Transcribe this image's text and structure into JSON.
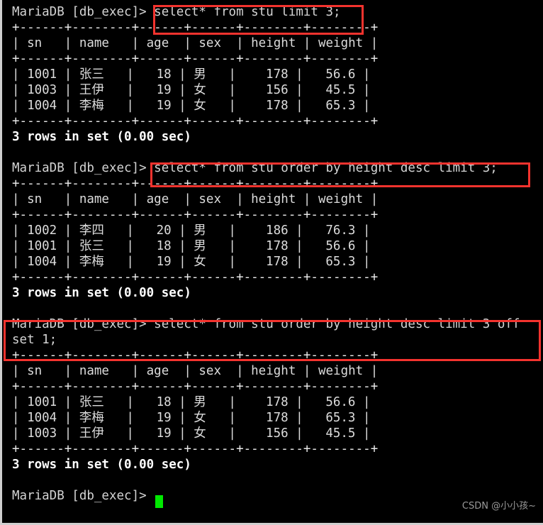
{
  "terminal": {
    "prompt": "MariaDB [db_exec]> ",
    "cursor_color": "#00e800",
    "text_color": "#d4d4d4",
    "background_color": "#000000",
    "highlight_color": "#f4332e",
    "lines": [
      {
        "id": "l0",
        "kind": "prompt",
        "text": "MariaDB [db_exec]> select* from stu limit 3;"
      },
      {
        "id": "l1",
        "kind": "rule",
        "text": "+------+--------+------+------+--------+--------+"
      },
      {
        "id": "l2",
        "kind": "data",
        "text": "| sn   | name   | age  | sex  | height | weight |"
      },
      {
        "id": "l3",
        "kind": "rule",
        "text": "+------+--------+------+------+--------+--------+"
      },
      {
        "id": "l4",
        "kind": "data",
        "text": "| 1001 | 张三   |   18 | 男   |    178 |   56.6 |"
      },
      {
        "id": "l5",
        "kind": "data",
        "text": "| 1003 | 王伊   |   19 | 女   |    156 |   45.5 |"
      },
      {
        "id": "l6",
        "kind": "data",
        "text": "| 1004 | 李梅   |   19 | 女   |    178 |   65.3 |"
      },
      {
        "id": "l7",
        "kind": "rule",
        "text": "+------+--------+------+------+--------+--------+"
      },
      {
        "id": "l8",
        "kind": "bright",
        "text": "3 rows in set (0.00 sec)"
      },
      {
        "id": "l9",
        "kind": "blank",
        "text": " "
      },
      {
        "id": "l10",
        "kind": "prompt",
        "text": "MariaDB [db_exec]> select* from stu order by height desc limit 3;"
      },
      {
        "id": "l11",
        "kind": "rule",
        "text": "+------+--------+------+------+--------+--------+"
      },
      {
        "id": "l12",
        "kind": "data",
        "text": "| sn   | name   | age  | sex  | height | weight |"
      },
      {
        "id": "l13",
        "kind": "rule",
        "text": "+------+--------+------+------+--------+--------+"
      },
      {
        "id": "l14",
        "kind": "data",
        "text": "| 1002 | 李四   |   20 | 男   |    186 |   76.3 |"
      },
      {
        "id": "l15",
        "kind": "data",
        "text": "| 1001 | 张三   |   18 | 男   |    178 |   56.6 |"
      },
      {
        "id": "l16",
        "kind": "data",
        "text": "| 1004 | 李梅   |   19 | 女   |    178 |   65.3 |"
      },
      {
        "id": "l17",
        "kind": "rule",
        "text": "+------+--------+------+------+--------+--------+"
      },
      {
        "id": "l18",
        "kind": "bright",
        "text": "3 rows in set (0.00 sec)"
      },
      {
        "id": "l19",
        "kind": "blank",
        "text": " "
      },
      {
        "id": "l20",
        "kind": "prompt",
        "text": "MariaDB [db_exec]> select* from stu order by height desc limit 3 off"
      },
      {
        "id": "l21",
        "kind": "prompt",
        "text": "set 1;"
      },
      {
        "id": "l22",
        "kind": "rule",
        "text": "+------+--------+------+------+--------+--------+"
      },
      {
        "id": "l23",
        "kind": "data",
        "text": "| sn   | name   | age  | sex  | height | weight |"
      },
      {
        "id": "l24",
        "kind": "rule",
        "text": "+------+--------+------+------+--------+--------+"
      },
      {
        "id": "l25",
        "kind": "data",
        "text": "| 1001 | 张三   |   18 | 男   |    178 |   56.6 |"
      },
      {
        "id": "l26",
        "kind": "data",
        "text": "| 1004 | 李梅   |   19 | 女   |    178 |   65.3 |"
      },
      {
        "id": "l27",
        "kind": "data",
        "text": "| 1003 | 王伊   |   19 | 女   |    156 |   45.5 |"
      },
      {
        "id": "l28",
        "kind": "rule",
        "text": "+------+--------+------+------+--------+--------+"
      },
      {
        "id": "l29",
        "kind": "bright",
        "text": "3 rows in set (0.00 sec)"
      },
      {
        "id": "l30",
        "kind": "blank",
        "text": " "
      },
      {
        "id": "l31",
        "kind": "prompt",
        "text": "MariaDB [db_exec]> "
      }
    ],
    "queries": [
      {
        "id": "q1",
        "sql": "select* from stu limit 3;",
        "result_status": "3 rows in set (0.00 sec)"
      },
      {
        "id": "q2",
        "sql": "select* from stu order by height desc limit 3;",
        "result_status": "3 rows in set (0.00 sec)"
      },
      {
        "id": "q3",
        "sql": "select* from stu order by height desc limit 3 offset 1;",
        "result_status": "3 rows in set (0.00 sec)"
      }
    ],
    "result_tables": [
      {
        "id": "t1",
        "columns": [
          "sn",
          "name",
          "age",
          "sex",
          "height",
          "weight"
        ],
        "rows": [
          [
            "1001",
            "张三",
            "18",
            "男",
            "178",
            "56.6"
          ],
          [
            "1003",
            "王伊",
            "19",
            "女",
            "156",
            "45.5"
          ],
          [
            "1004",
            "李梅",
            "19",
            "女",
            "178",
            "65.3"
          ]
        ]
      },
      {
        "id": "t2",
        "columns": [
          "sn",
          "name",
          "age",
          "sex",
          "height",
          "weight"
        ],
        "rows": [
          [
            "1002",
            "李四",
            "20",
            "男",
            "186",
            "76.3"
          ],
          [
            "1001",
            "张三",
            "18",
            "男",
            "178",
            "56.6"
          ],
          [
            "1004",
            "李梅",
            "19",
            "女",
            "178",
            "65.3"
          ]
        ]
      },
      {
        "id": "t3",
        "columns": [
          "sn",
          "name",
          "age",
          "sex",
          "height",
          "weight"
        ],
        "rows": [
          [
            "1001",
            "张三",
            "18",
            "男",
            "178",
            "56.6"
          ],
          [
            "1004",
            "李梅",
            "19",
            "女",
            "178",
            "65.3"
          ],
          [
            "1003",
            "王伊",
            "19",
            "女",
            "156",
            "45.5"
          ]
        ]
      }
    ],
    "highlights": [
      {
        "id": "h1",
        "label": "limit-clause-highlight"
      },
      {
        "id": "h2",
        "label": "order-by-limit-highlight"
      },
      {
        "id": "h3",
        "label": "limit-offset-highlight"
      }
    ]
  },
  "watermark": {
    "text": "CSDN @小小孩~"
  }
}
